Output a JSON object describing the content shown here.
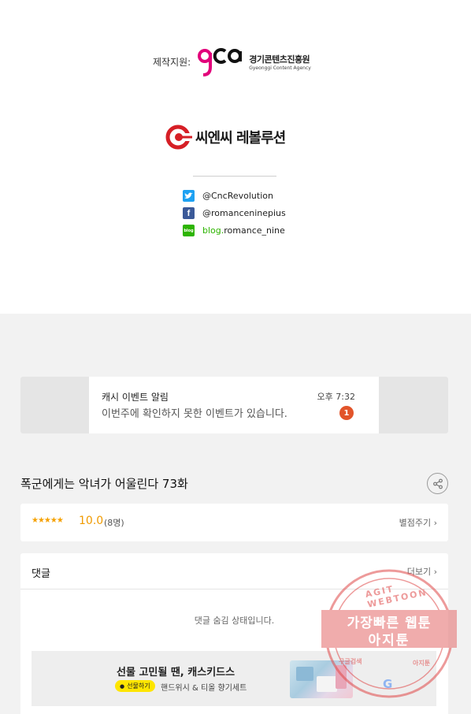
{
  "credits": {
    "support_label": "제작지원:",
    "gca_korean": "경기콘텐츠진흥원",
    "gca_english": "Gyeonggi Content Agency",
    "studio_name": "씨엔씨 레볼루션",
    "social": [
      {
        "icon": "twitter-icon",
        "text": "@CncRevolution"
      },
      {
        "icon": "facebook-icon",
        "text": "@romanceninepius"
      },
      {
        "icon": "blog-icon",
        "prefix": "blog.",
        "text": "romance_nine"
      }
    ]
  },
  "notification": {
    "title": "캐시 이벤트 알림",
    "time": "오후 7:32",
    "body": "이번주에 확인하지 못한 이벤트가 있습니다.",
    "badge": "1"
  },
  "episode": {
    "title": "폭군에게는 악녀가 어울린다 73화"
  },
  "rating": {
    "stars": "★★★★★",
    "score": "10.0",
    "count": "(8명)",
    "rate_label": "별점주기 ›"
  },
  "comments": {
    "title": "댓글",
    "more_label": "더보기 ›",
    "hidden_message": "댓글 숨김 상태입니다."
  },
  "ad": {
    "title": "선물 고민될 땐, 캐스키드스",
    "tag": "선물하기",
    "subtitle": "핸드위시 & 티올 향기세트"
  },
  "watermark": {
    "top_text": "AGIT WEBTOON",
    "line1": "가장빠른 웹툰",
    "line2": "아지툰",
    "left_text": "구글검색",
    "right_text": "아지툰",
    "google": "G"
  },
  "colors": {
    "accent_orange": "#f09a00",
    "badge_red": "#e2542a",
    "brand_magenta": "#e2007a",
    "brand_red": "#d61f26"
  }
}
